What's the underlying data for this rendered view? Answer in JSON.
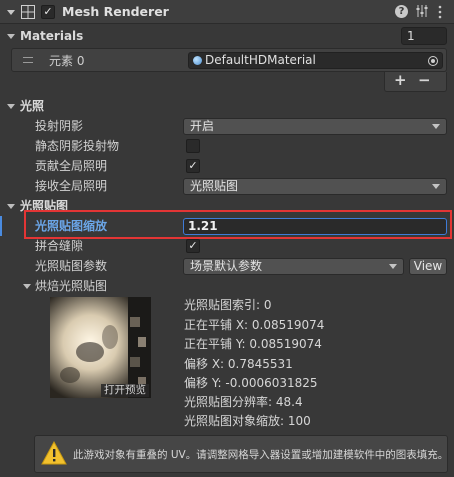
{
  "header": {
    "title": "Mesh Renderer",
    "enabled_check": "✓"
  },
  "materials": {
    "title": "Materials",
    "count": "1",
    "element_label": "元素 0",
    "material_value": "DefaultHDMaterial",
    "add_label": "+",
    "remove_label": "−"
  },
  "lighting": {
    "title": "光照",
    "cast_shadows_label": "投射阴影",
    "cast_shadows_value": "开启",
    "static_shadow_caster_label": "静态阴影投射物",
    "contribute_gi_label": "贡献全局照明",
    "contribute_gi_check": "✓",
    "receive_gi_label": "接收全局照明",
    "receive_gi_value": "光照贴图"
  },
  "lightmapping": {
    "title": "光照贴图",
    "scale_label": "光照贴图缩放",
    "scale_value": "1.21",
    "stitch_seams_label": "拼合缝隙",
    "stitch_seams_check": "✓",
    "parameters_label": "光照贴图参数",
    "parameters_value": "场景默认参数",
    "view_label": "View"
  },
  "baked": {
    "title": "烘焙光照贴图",
    "open_preview_label": "打开预览",
    "stats": [
      "光照贴图索引: 0",
      "正在平铺 X: 0.08519074",
      "正在平铺 Y: 0.08519074",
      "偏移 X: 0.7845531",
      "偏移 Y: -0.0006031825",
      "光照贴图分辨率: 48.4",
      "光照贴图对象缩放: 100"
    ]
  },
  "warning": {
    "text": "此游戏对象有重叠的 UV。请调整网格导入器设置或增加建模软件中的图表填充。"
  },
  "colors": {
    "highlight_box": "#e33535",
    "active_label": "#6ba6e8",
    "scale_field_border": "#3e7bd8"
  }
}
